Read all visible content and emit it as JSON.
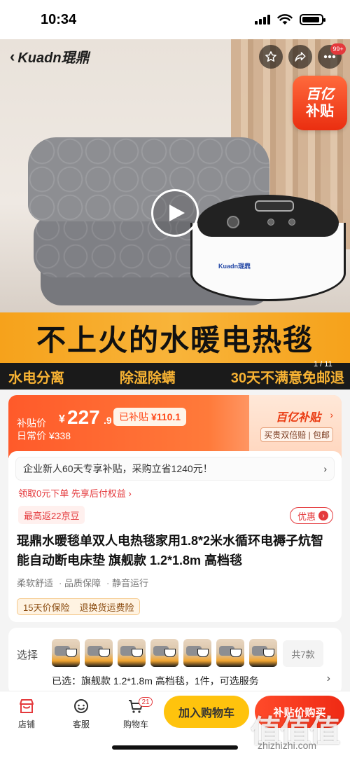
{
  "status_bar": {
    "time": "10:34"
  },
  "hero": {
    "brand": "Kuadn琨鼎",
    "device_logo": "Kuadn琨鼎",
    "more_badge": "99+",
    "subsidy_badge": {
      "line1": "百亿",
      "line2": "补贴"
    },
    "headline": "不上火的水暖电热毯",
    "features": [
      "水电分离",
      "除湿除螨",
      "30天不满意免邮退"
    ],
    "image_counter": "1 / 11"
  },
  "price": {
    "label": "补贴价",
    "currency": "¥",
    "integer": "227",
    "decimal": ".9",
    "subsidized_label": "已补贴",
    "subsidized_amount": "¥110.1",
    "daily_price": "日常价 ¥338",
    "program": "百亿补贴",
    "program_sub": "买贵双倍赔 | 包邮"
  },
  "info": {
    "new_user": "企业新人60天专享补贴，采购立省1240元！",
    "pay_later": "领取0元下单 先享后付权益 ›",
    "rebate": "最高返22京豆",
    "discount": "优惠",
    "title": "琨鼎水暖毯单双人电热毯家用1.8*2米水循环电褥子炕智能自动断电床垫 旗舰款 1.2*1.8m 高档毯",
    "tags": [
      "柔软舒适",
      "品质保障",
      "静音运行"
    ],
    "guarantee": [
      "15天价保险",
      "退换货运费险"
    ]
  },
  "selection": {
    "label": "选择",
    "total_styles": "共7款",
    "selected": "已选：旗舰款 1.2*1.8m 高档毯，1件，可选服务"
  },
  "bottom": {
    "shop": "店铺",
    "service": "客服",
    "cart": "购物车",
    "cart_count": "21",
    "add_to_cart": "加入购物车",
    "buy_now": "补贴价购买"
  },
  "watermark": {
    "logo": "值值值",
    "url": "zhizhizhi.com"
  },
  "colors": {
    "accent": "#e4393c",
    "headline_band": "#f6a21b",
    "add_cart": "#ffc30d"
  }
}
